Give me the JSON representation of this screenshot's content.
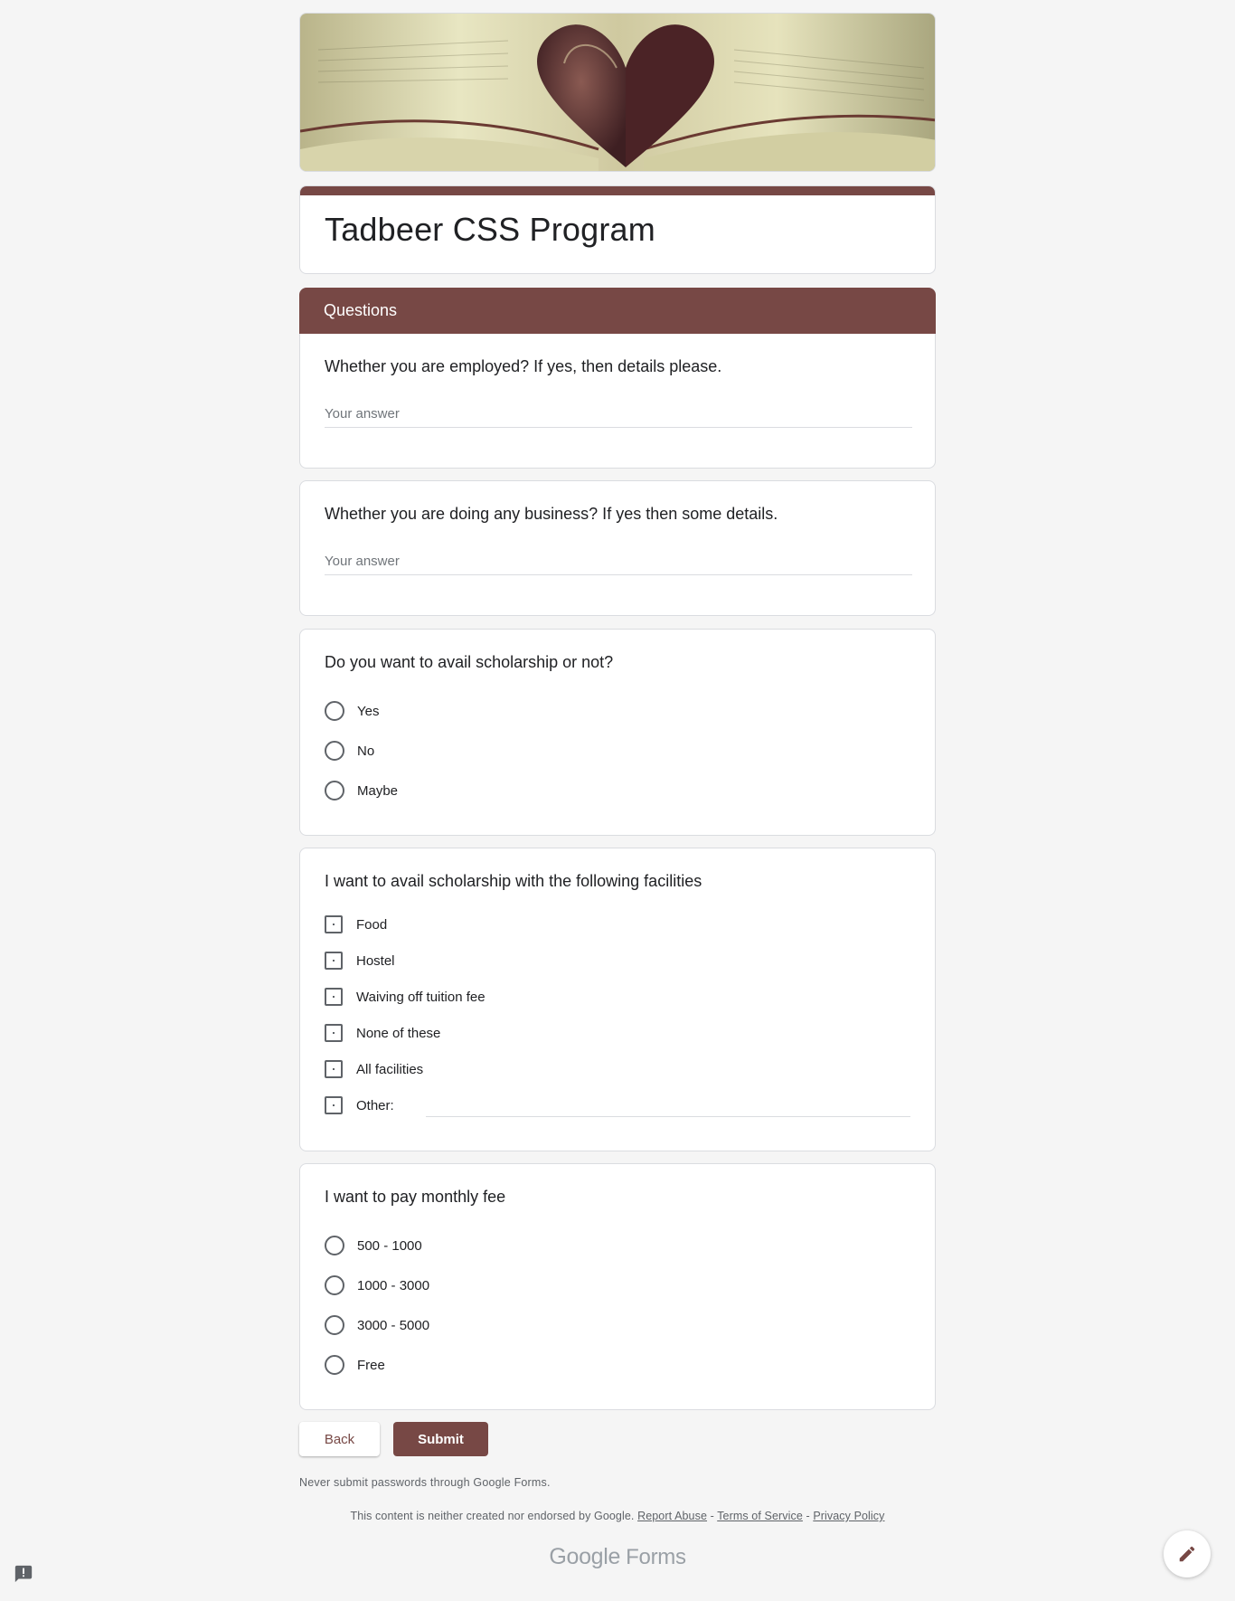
{
  "form": {
    "title": "Tadbeer CSS Program",
    "section_title": "Questions",
    "accent_color": "#774845"
  },
  "questions": [
    {
      "title": "Whether you are employed? If yes, then details please.",
      "type": "text",
      "placeholder": "Your answer"
    },
    {
      "title": "Whether you are doing any business? If yes then some details.",
      "type": "text",
      "placeholder": "Your answer"
    },
    {
      "title": "Do you want to avail scholarship or not?",
      "type": "radio",
      "options": [
        "Yes",
        "No",
        "Maybe"
      ]
    },
    {
      "title": "I want to avail scholarship with the following facilities",
      "type": "checkbox",
      "options": [
        "Food",
        "Hostel",
        "Waiving off tuition fee",
        "None of these",
        "All facilities",
        "Other:"
      ]
    },
    {
      "title": "I want to pay monthly fee",
      "type": "radio",
      "options": [
        "500 - 1000",
        "1000 - 3000",
        "3000 - 5000",
        "Free"
      ]
    }
  ],
  "buttons": {
    "back": "Back",
    "submit": "Submit"
  },
  "warning": "Never submit passwords through Google Forms.",
  "footer": {
    "disclaimer": "This content is neither created nor endorsed by Google.",
    "report_abuse": "Report Abuse",
    "separator": " - ",
    "terms": "Terms of Service",
    "privacy": "Privacy Policy"
  },
  "logo": {
    "google": "Google",
    "forms": "Forms"
  },
  "icons": {
    "edit": "pencil-icon",
    "report": "report-problem-icon"
  }
}
